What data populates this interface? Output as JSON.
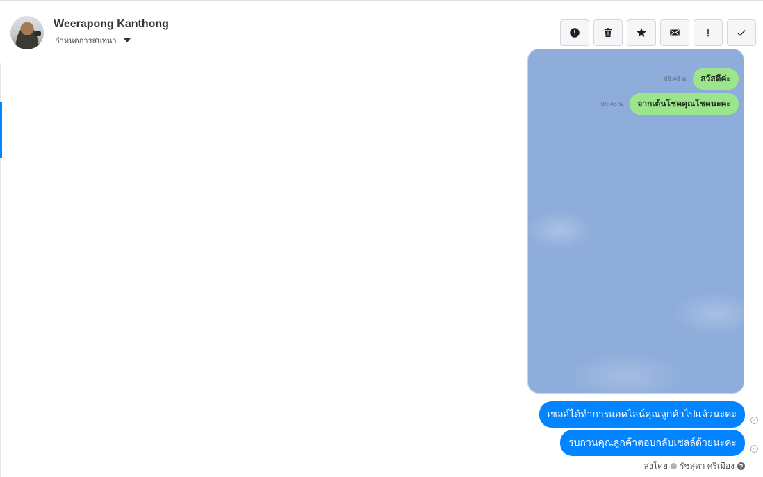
{
  "header": {
    "contact_name": "Weerapong Kanthong",
    "assign_label": "กำหนดการสนทนา",
    "actions": [
      {
        "icon": "alert-circle-icon"
      },
      {
        "icon": "trash-icon"
      },
      {
        "icon": "star-icon"
      },
      {
        "icon": "envelope-icon"
      },
      {
        "icon": "exclamation-icon"
      },
      {
        "icon": "check-icon"
      }
    ]
  },
  "attachment": {
    "messages": [
      {
        "time": "08:48 น.",
        "text": "สวัสดีค่ะ"
      },
      {
        "time": "08:48 น.",
        "text": "จากเต้นโชคคุณโชคนะคะ"
      }
    ],
    "background_color": "#8eaddb",
    "bubble_color": "#9ce58d"
  },
  "messages": [
    {
      "text": "เซลล์ได้ทำการแอดไลน์คุณลูกค้าไปแล้วนะคะ"
    },
    {
      "text": "รบกวนคุณลูกค้าตอบกลับเซลล์ด้วยนะคะ"
    }
  ],
  "sent_by": {
    "prefix": "ส่งโดย",
    "name": "รัชสุดา ศรีเมือง",
    "help_icon": "?"
  },
  "colors": {
    "accent": "#0084ff"
  }
}
